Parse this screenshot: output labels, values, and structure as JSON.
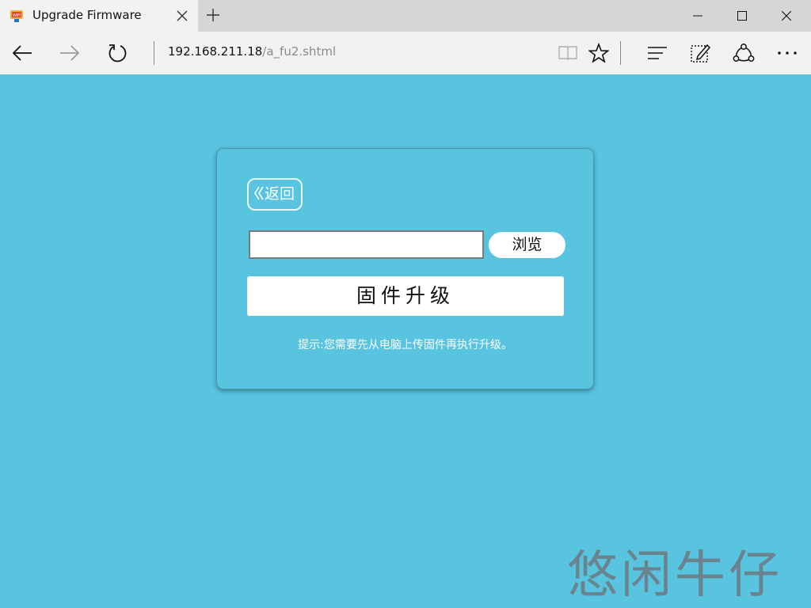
{
  "tab": {
    "title": "Upgrade Firmware",
    "favicon": "router-wifi-icon"
  },
  "address_bar": {
    "host": "192.168.211.18",
    "path": "/a_fu2.shtml"
  },
  "toolbar": {
    "icons": [
      "reading-view-icon",
      "favorite-star-icon",
      "hub-icon",
      "web-note-icon",
      "share-icon",
      "more-icon"
    ]
  },
  "page": {
    "back_label": "返回",
    "file_input_value": "",
    "browse_label": "浏览",
    "upgrade_label": "固件升级",
    "hint": "提示:您需要先从电脑上传固件再执行升级。"
  },
  "watermark": "悠闲牛仔",
  "colors": {
    "page_background": "#58c4e0",
    "button_background": "#ffffff",
    "chrome_background": "#f2f2f2"
  }
}
